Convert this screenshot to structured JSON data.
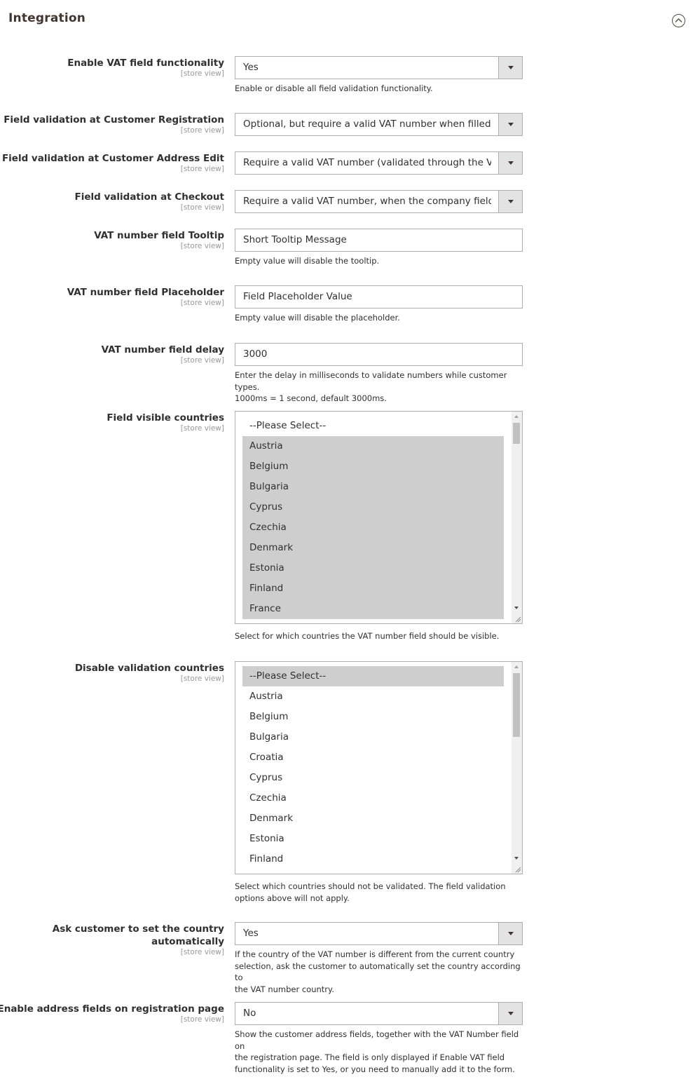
{
  "section": {
    "title": "Integration",
    "collapse_icon": "chevron-up-circle-icon"
  },
  "scope_label": "[store view]",
  "fields": {
    "enable_vat": {
      "label": "Enable VAT field functionality",
      "value": "Yes",
      "note": "Enable or disable all field validation functionality."
    },
    "validation_registration": {
      "label": "Field validation at Customer Registration",
      "value": "Optional, but require a valid VAT number when filled"
    },
    "validation_address_edit": {
      "label": "Field validation at Customer Address Edit",
      "value": "Require a valid VAT number (validated through the VIES service)"
    },
    "validation_checkout": {
      "label": "Field validation at Checkout",
      "value": "Require a valid VAT number, when the company field is filled"
    },
    "tooltip": {
      "label": "VAT number field Tooltip",
      "value": "Short Tooltip Message",
      "note": "Empty value will disable the tooltip."
    },
    "placeholder": {
      "label": "VAT number field Placeholder",
      "value": "Field Placeholder Value",
      "note": "Empty value will disable the placeholder."
    },
    "delay": {
      "label": "VAT number field delay",
      "value": "3000",
      "note_line1": "Enter the delay in milliseconds to validate numbers while customer types.",
      "note_line2": "1000ms = 1 second, default 3000ms."
    },
    "visible_countries": {
      "label": "Field visible countries",
      "options": [
        {
          "label": "--Please Select--",
          "selected": false
        },
        {
          "label": "Austria",
          "selected": true
        },
        {
          "label": "Belgium",
          "selected": true
        },
        {
          "label": "Bulgaria",
          "selected": true
        },
        {
          "label": "Cyprus",
          "selected": true
        },
        {
          "label": "Czechia",
          "selected": true
        },
        {
          "label": "Denmark",
          "selected": true
        },
        {
          "label": "Estonia",
          "selected": true
        },
        {
          "label": "Finland",
          "selected": true
        },
        {
          "label": "France",
          "selected": true
        }
      ],
      "note": "Select for which countries the VAT number field should be visible."
    },
    "disable_countries": {
      "label": "Disable validation countries",
      "options": [
        {
          "label": "--Please Select--",
          "selected": true
        },
        {
          "label": "Austria",
          "selected": false
        },
        {
          "label": "Belgium",
          "selected": false
        },
        {
          "label": "Bulgaria",
          "selected": false
        },
        {
          "label": "Croatia",
          "selected": false
        },
        {
          "label": "Cyprus",
          "selected": false
        },
        {
          "label": "Czechia",
          "selected": false
        },
        {
          "label": "Denmark",
          "selected": false
        },
        {
          "label": "Estonia",
          "selected": false
        },
        {
          "label": "Finland",
          "selected": false
        }
      ],
      "note_line1": "Select which countries should not be validated. The field validation",
      "note_line2": "options above will not apply."
    },
    "ask_country": {
      "label_line1": "Ask customer to set the country",
      "label_line2": "automatically",
      "value": "Yes",
      "note_line1": "If the country of the VAT number is different from the current country",
      "note_line2": "selection, ask the customer to automatically set the country according to",
      "note_line3": "the VAT number country."
    },
    "address_fields": {
      "label": "Enable address fields on registration page",
      "value": "No",
      "note_line1": "Show the customer address fields, together with the VAT Number field on",
      "note_line2": "the registration page. The field is only displayed if Enable VAT field",
      "note_line3": "functionality is set to Yes, or you need to manually add it to the form."
    }
  }
}
